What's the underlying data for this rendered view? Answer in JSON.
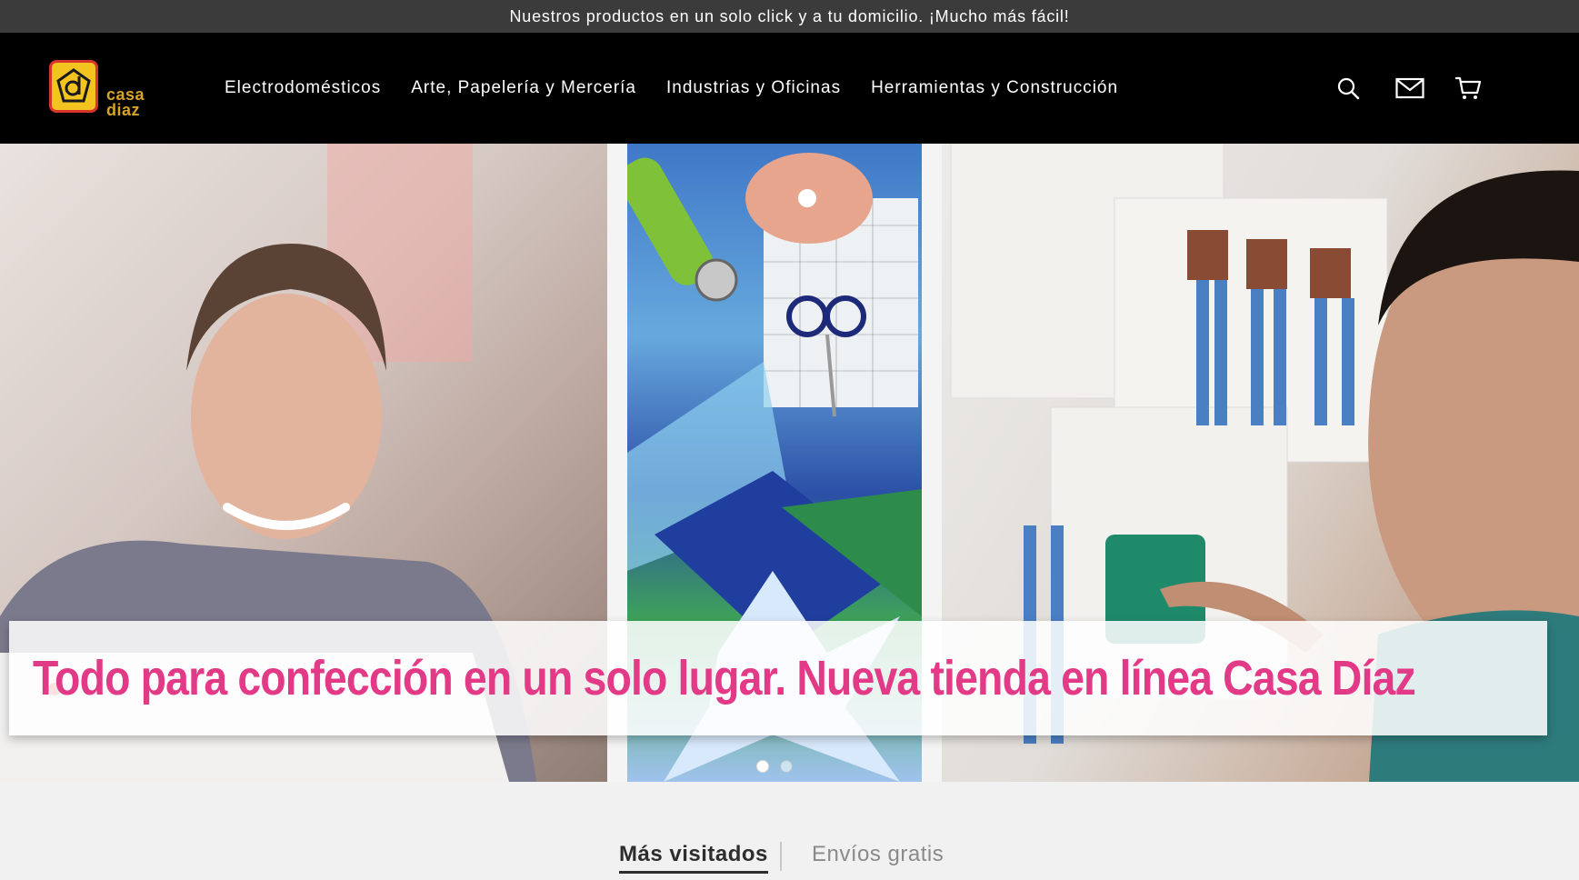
{
  "announcement": "Nuestros productos en un solo click y a tu domicilio. ¡Mucho más fácil!",
  "header": {
    "logo_text_line1": "casa",
    "logo_text_line2": "diaz",
    "nav": [
      "Electrodomésticos",
      "Arte, Papelería y Mercería",
      "Industrias y Oficinas",
      "Herramientas y Construcción"
    ],
    "icons": [
      "search-icon",
      "mail-icon",
      "cart-icon"
    ]
  },
  "hero": {
    "banner_text": "Todo para confección en un solo lugar. Nueva tienda en línea Casa Díaz",
    "banner_color": "#e33a87",
    "slides_count": 2,
    "active_slide": 1
  },
  "tabs": {
    "items": [
      "Más visitados",
      "Envíos gratis"
    ],
    "active": 0
  },
  "colors": {
    "announce_bg": "#3b3b3b",
    "header_bg": "#000000",
    "logo_yellow": "#f3c31f",
    "logo_red": "#d9342b"
  }
}
